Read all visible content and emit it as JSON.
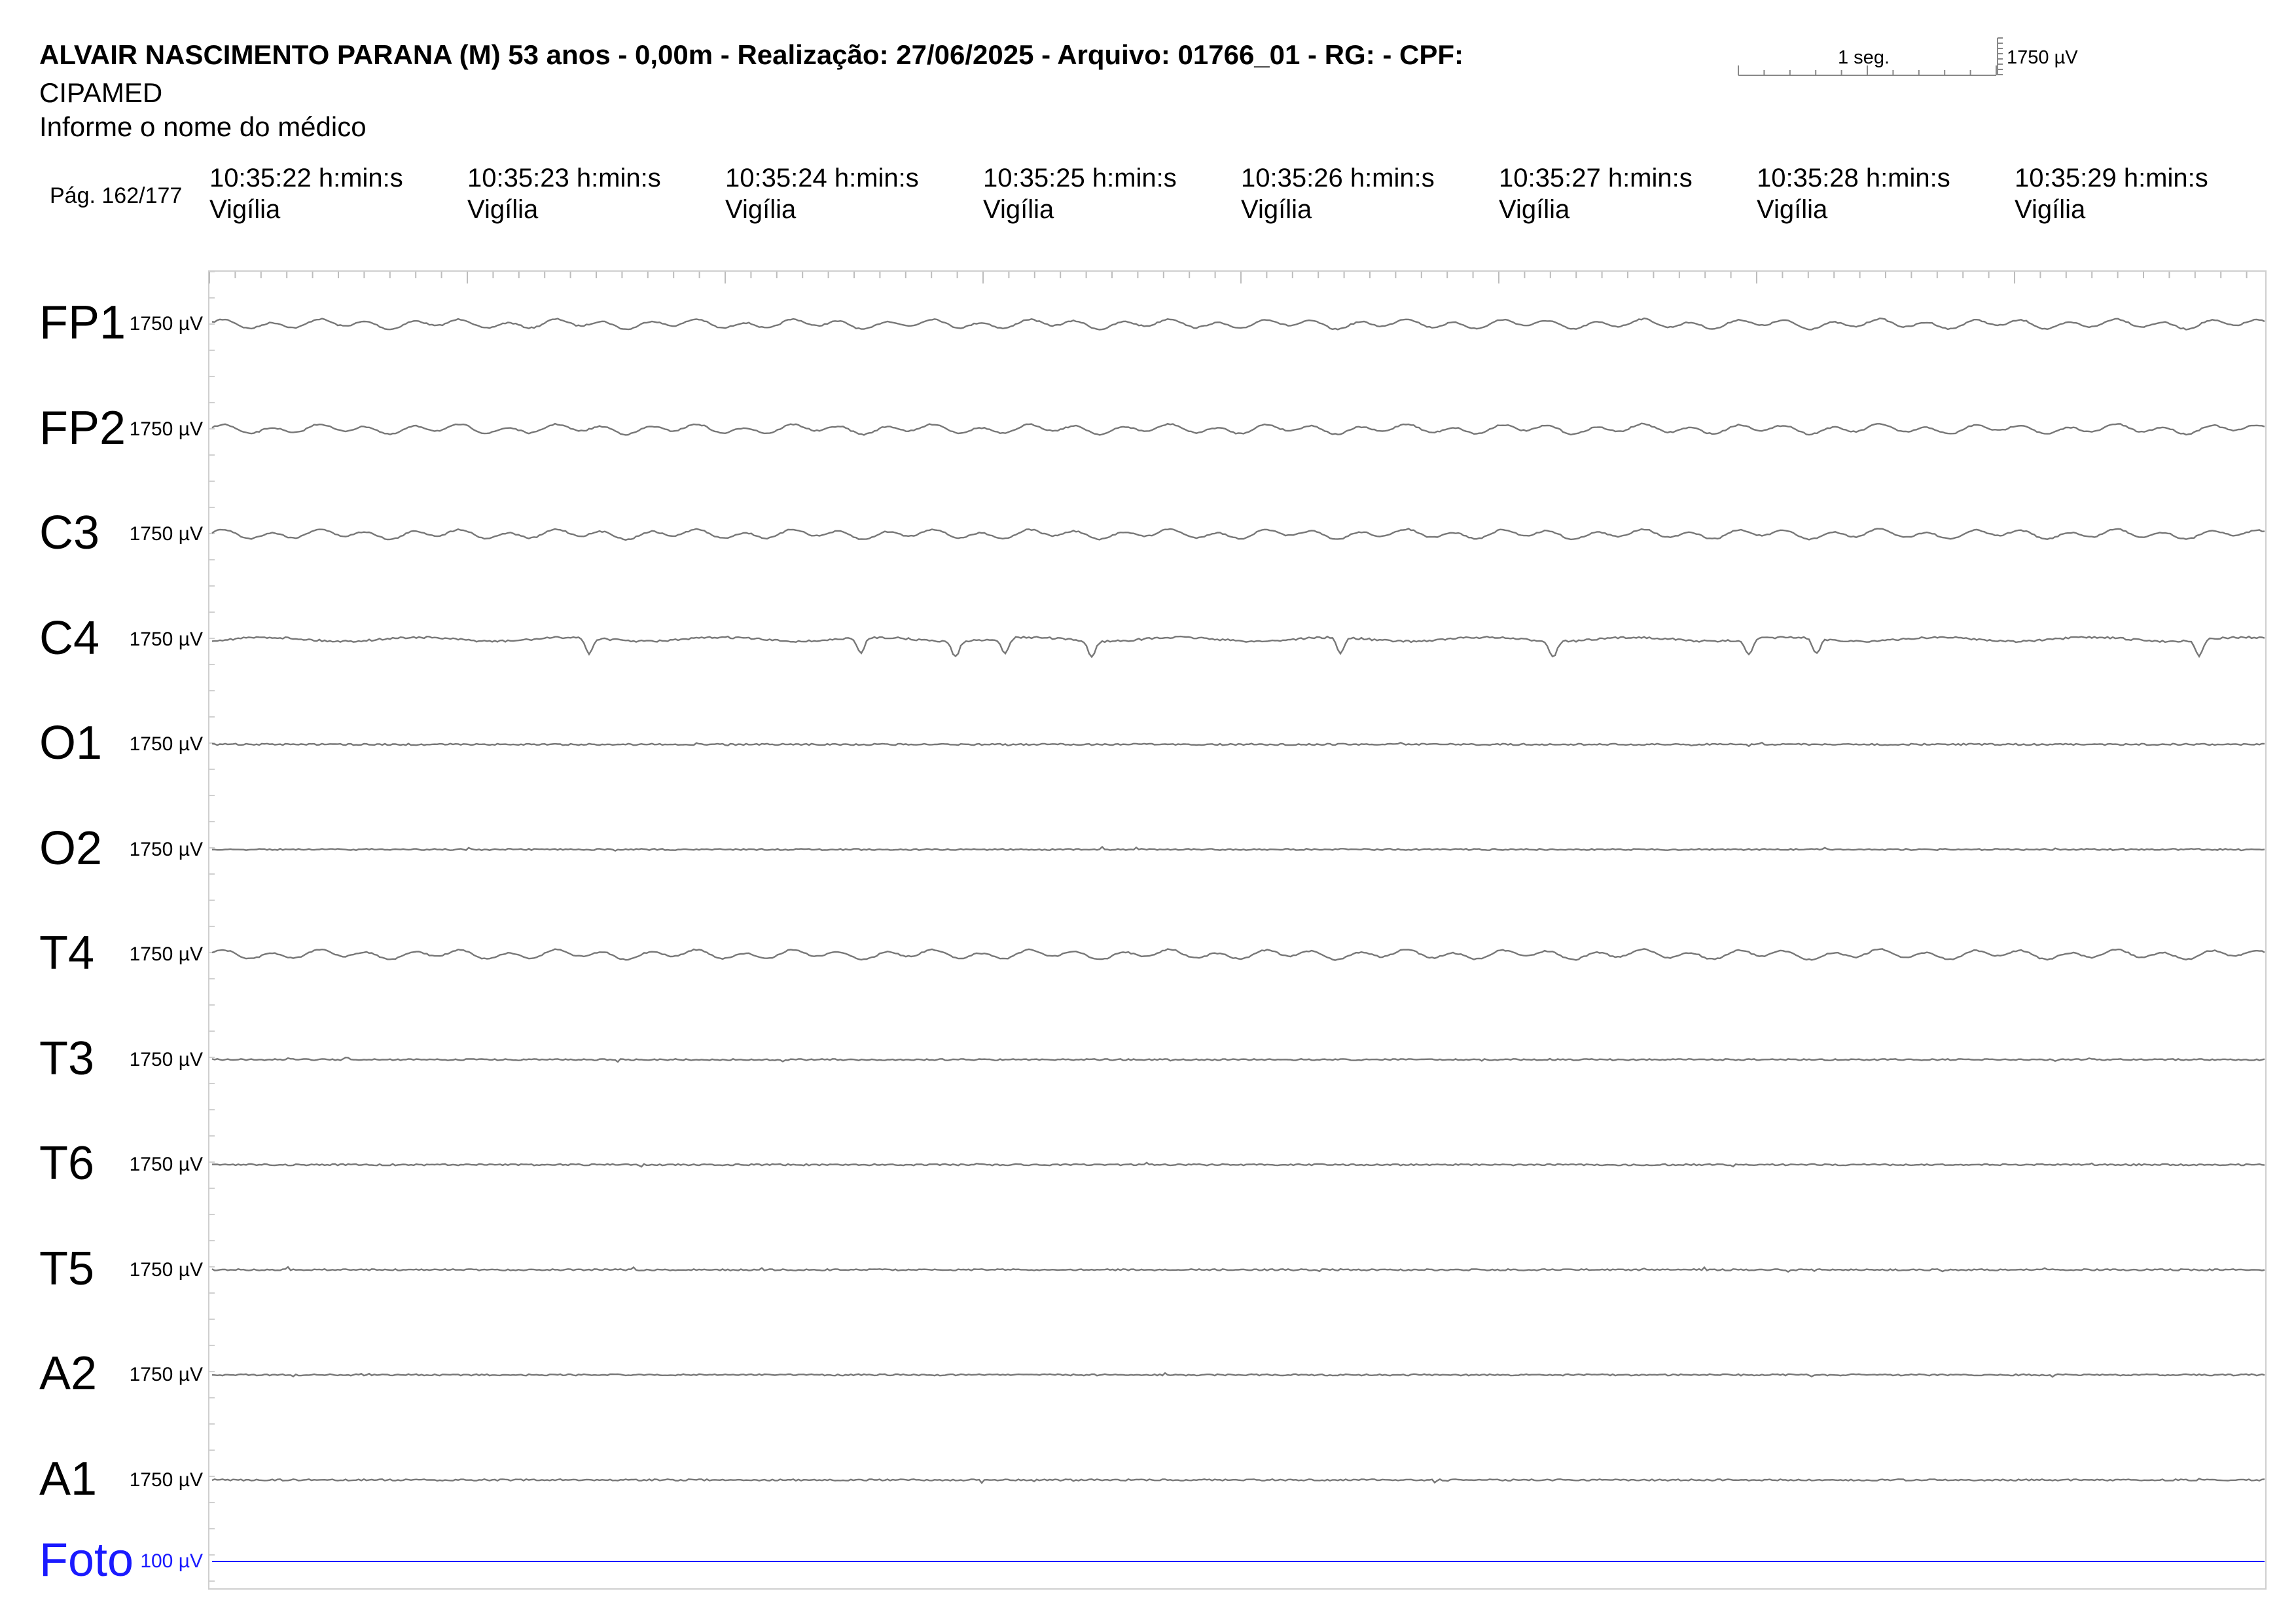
{
  "header": {
    "title": "ALVAIR NASCIMENTO PARANA (M) 53 anos - 0,00m - Realização: 27/06/2025 - Arquivo: 01766_01 - RG:  - CPF:",
    "clinic": "CIPAMED",
    "physician_prompt": "Informe o nome do médico",
    "page": "Pág. 162/177"
  },
  "scale": {
    "time_label": "1 seg.",
    "amplitude_label": "1750 µV"
  },
  "epochs": [
    {
      "time": "10:35:22 h:min:s",
      "state": "Vigília"
    },
    {
      "time": "10:35:23 h:min:s",
      "state": "Vigília"
    },
    {
      "time": "10:35:24 h:min:s",
      "state": "Vigília"
    },
    {
      "time": "10:35:25 h:min:s",
      "state": "Vigília"
    },
    {
      "time": "10:35:26 h:min:s",
      "state": "Vigília"
    },
    {
      "time": "10:35:27 h:min:s",
      "state": "Vigília"
    },
    {
      "time": "10:35:28 h:min:s",
      "state": "Vigília"
    },
    {
      "time": "10:35:29 h:min:s",
      "state": "Vigília"
    }
  ],
  "channels": [
    {
      "name": "FP1",
      "gain": "1750 µV",
      "activity": "rhythmic",
      "color": "#777777"
    },
    {
      "name": "FP2",
      "gain": "1750 µV",
      "activity": "rhythmic",
      "color": "#777777"
    },
    {
      "name": "C3",
      "gain": "1750 µV",
      "activity": "rhythmic",
      "color": "#777777"
    },
    {
      "name": "C4",
      "gain": "1750 µV",
      "activity": "spiky",
      "color": "#777777"
    },
    {
      "name": "O1",
      "gain": "1750 µV",
      "activity": "flat",
      "color": "#777777"
    },
    {
      "name": "O2",
      "gain": "1750 µV",
      "activity": "flat",
      "color": "#777777"
    },
    {
      "name": "T4",
      "gain": "1750 µV",
      "activity": "rhythmic",
      "color": "#777777"
    },
    {
      "name": "T3",
      "gain": "1750 µV",
      "activity": "flat",
      "color": "#777777"
    },
    {
      "name": "T6",
      "gain": "1750 µV",
      "activity": "flat",
      "color": "#777777"
    },
    {
      "name": "T5",
      "gain": "1750 µV",
      "activity": "flat",
      "color": "#777777"
    },
    {
      "name": "A2",
      "gain": "1750 µV",
      "activity": "flat",
      "color": "#777777"
    },
    {
      "name": "A1",
      "gain": "1750 µV",
      "activity": "flat",
      "color": "#777777"
    },
    {
      "name": "Foto",
      "gain": "100 µV",
      "activity": "line",
      "color": "#1a1aff"
    }
  ],
  "colors": {
    "trace": "#777777",
    "photic": "#1a1aff",
    "frame": "#cfcfcf"
  }
}
